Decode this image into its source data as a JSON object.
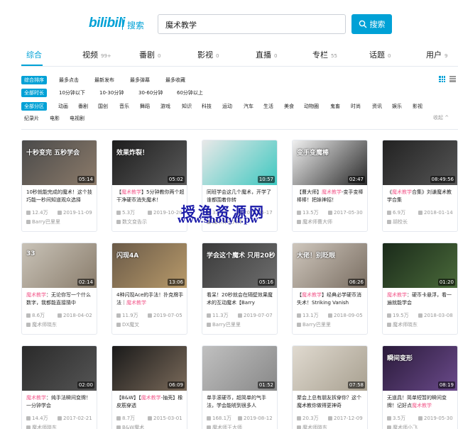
{
  "header": {
    "logo_text": "bilibili",
    "logo_sub": "搜索",
    "search_value": "魔术教学",
    "search_button": "搜索"
  },
  "tabs": [
    {
      "label": "综合",
      "count": ""
    },
    {
      "label": "视频",
      "count": "99+"
    },
    {
      "label": "番剧",
      "count": "0"
    },
    {
      "label": "影视",
      "count": "0"
    },
    {
      "label": "直播",
      "count": "0"
    },
    {
      "label": "专栏",
      "count": "55"
    },
    {
      "label": "话题",
      "count": "0"
    },
    {
      "label": "用户",
      "count": "9"
    }
  ],
  "filters": {
    "order": [
      "综合排序",
      "最多点击",
      "最新发布",
      "最多弹幕",
      "最多收藏"
    ],
    "duration": [
      "全部时长",
      "10分钟以下",
      "10-30分钟",
      "30-60分钟",
      "60分钟以上"
    ],
    "zone": [
      "全部分区",
      "动画",
      "番剧",
      "国创",
      "音乐",
      "舞蹈",
      "游戏",
      "知识",
      "科技",
      "运动",
      "汽车",
      "生活",
      "美食",
      "动物圈",
      "鬼畜",
      "时尚",
      "资讯",
      "娱乐",
      "影视"
    ],
    "zone2": [
      "纪录片",
      "电影",
      "电视剧"
    ],
    "collapse": "收起 ^"
  },
  "videos": [
    {
      "duration": "05:14",
      "overlay": "十秒变完 五秒学会",
      "title": "10秒就能完成的魔术！这个技巧能一秒间知道观众选择",
      "hl": "",
      "views": "12.4万",
      "date": "2019-11-09",
      "up": "Barry巴里里",
      "colors": [
        "#4a4a4a",
        "#8c7b6a"
      ]
    },
    {
      "duration": "05:02",
      "overlay": "效果炸裂！",
      "title": "【魔术教学】5分钟教你两个超干净硬币消失魔术！",
      "hl": "魔术教学",
      "views": "5.3万",
      "date": "2019-10-20",
      "up": "数文变告示",
      "colors": [
        "#1d1d1d",
        "#5a5a5a"
      ]
    },
    {
      "duration": "10:57",
      "overlay": "",
      "title": "同班学会这几个魔术，开学了谁都围着你转",
      "hl": "",
      "views": "33.5万",
      "date": "2021-05-17",
      "up": "魔术师王大师",
      "colors": [
        "#e8e8e8",
        "#3ec8c0"
      ]
    },
    {
      "duration": "02:47",
      "overlay": "变手变魔棒",
      "title": "【曹大师】魔术教学-变手变棒棒棒！把妹神招！",
      "hl": "魔术教学",
      "views": "13.5万",
      "date": "2017-05-30",
      "up": "魔术师曹大师",
      "colors": [
        "#f0f0f0",
        "#2a2a2a"
      ]
    },
    {
      "duration": "08:49:56",
      "overlay": "",
      "title": "《魔术教学合集》刘谦魔术教学合集",
      "hl": "魔术教学",
      "views": "6.9万",
      "date": "2018-01-14",
      "up": "胡校长",
      "colors": [
        "#222",
        "#555"
      ]
    },
    {
      "duration": "02:14",
      "overlay": "33",
      "title": "魔术教学：无论你写一个什么数字，我都能直接猜中",
      "hl": "魔术教学",
      "views": "8.6万",
      "date": "2018-04-02",
      "up": "魔术师晓东",
      "colors": [
        "#c9c3b8",
        "#8a7d6c"
      ]
    },
    {
      "duration": "13:06",
      "overlay": "闪现4A",
      "title": "4种闪现Ace的手法！扑克牌手法｜魔术教学",
      "hl": "魔术教学",
      "views": "11.9万",
      "date": "2019-07-05",
      "up": "DX魔叉",
      "colors": [
        "#6a5a48",
        "#b89a6a"
      ]
    },
    {
      "duration": "05:16",
      "overlay": "学会这个魔术 只用20秒",
      "title": "看呆！20秒就会在隔壁效果魔术的互动魔术【Barry",
      "hl": "",
      "views": "11.3万",
      "date": "2019-07-07",
      "up": "Barry巴里里",
      "colors": [
        "#3a3a3a",
        "#6e6e6e"
      ]
    },
    {
      "duration": "06:26",
      "overlay": "大佬！别眨眼",
      "title": "【魔术教学】经典必学硬币消失术！Striking Vanish",
      "hl": "魔术教学",
      "views": "13.1万",
      "date": "2018-09-05",
      "up": "Barry巴里里",
      "colors": [
        "#cfc7bd",
        "#7a6e62"
      ]
    },
    {
      "duration": "01:20",
      "overlay": "",
      "title": "魔术教学：硬币卡悬浮，看一遍就能学会",
      "hl": "魔术教学",
      "views": "19.5万",
      "date": "2018-03-08",
      "up": "魔术师晓东",
      "colors": [
        "#1a2a1a",
        "#4a6a3a"
      ]
    },
    {
      "duration": "02:00",
      "overlay": "",
      "title": "魔术教学：纯手法瞬间变牌！一分钟学会",
      "hl": "魔术教学",
      "views": "14.4万",
      "date": "2017-02-21",
      "up": "魔术师晓东",
      "colors": [
        "#2a2a2a",
        "#555"
      ]
    },
    {
      "duration": "06:09",
      "overlay": "",
      "title": "【B&W】【魔术教学-抽壳】橡皮筋穿透",
      "hl": "魔术教学",
      "views": "8.7万",
      "date": "2015-03-01",
      "up": "B&W魔术",
      "colors": [
        "#1a1a1a",
        "#7a6a5a"
      ]
    },
    {
      "duration": "01:52",
      "overlay": "",
      "title": "单手滚硬币，超简单的气手法，学会能唬到很多人",
      "hl": "",
      "views": "168.1万",
      "date": "2019-08-12",
      "up": "魔术师王大师",
      "colors": [
        "#c0c0c0",
        "#888"
      ]
    },
    {
      "duration": "07:58",
      "overlay": "",
      "title": "聚会上总有朋友拆穿你？这个魔术教你做得更神奇",
      "hl": "",
      "views": "20.3万",
      "date": "2017-12-09",
      "up": "魔术师晓东",
      "colors": [
        "#e0dad0",
        "#a8a090"
      ]
    },
    {
      "duration": "08:19",
      "overlay": "瞬间变形",
      "title": "无道具！简单短暂的瞬间变牌！记好点魔术教学",
      "hl": "魔术教学",
      "views": "3.5万",
      "date": "2019-05-30",
      "up": "魔术师小飞",
      "colors": [
        "#2a1a3a",
        "#6a4a8a"
      ]
    }
  ],
  "watermark": {
    "line1": "授渔资源网",
    "line2": "www.shouyu.pw"
  }
}
